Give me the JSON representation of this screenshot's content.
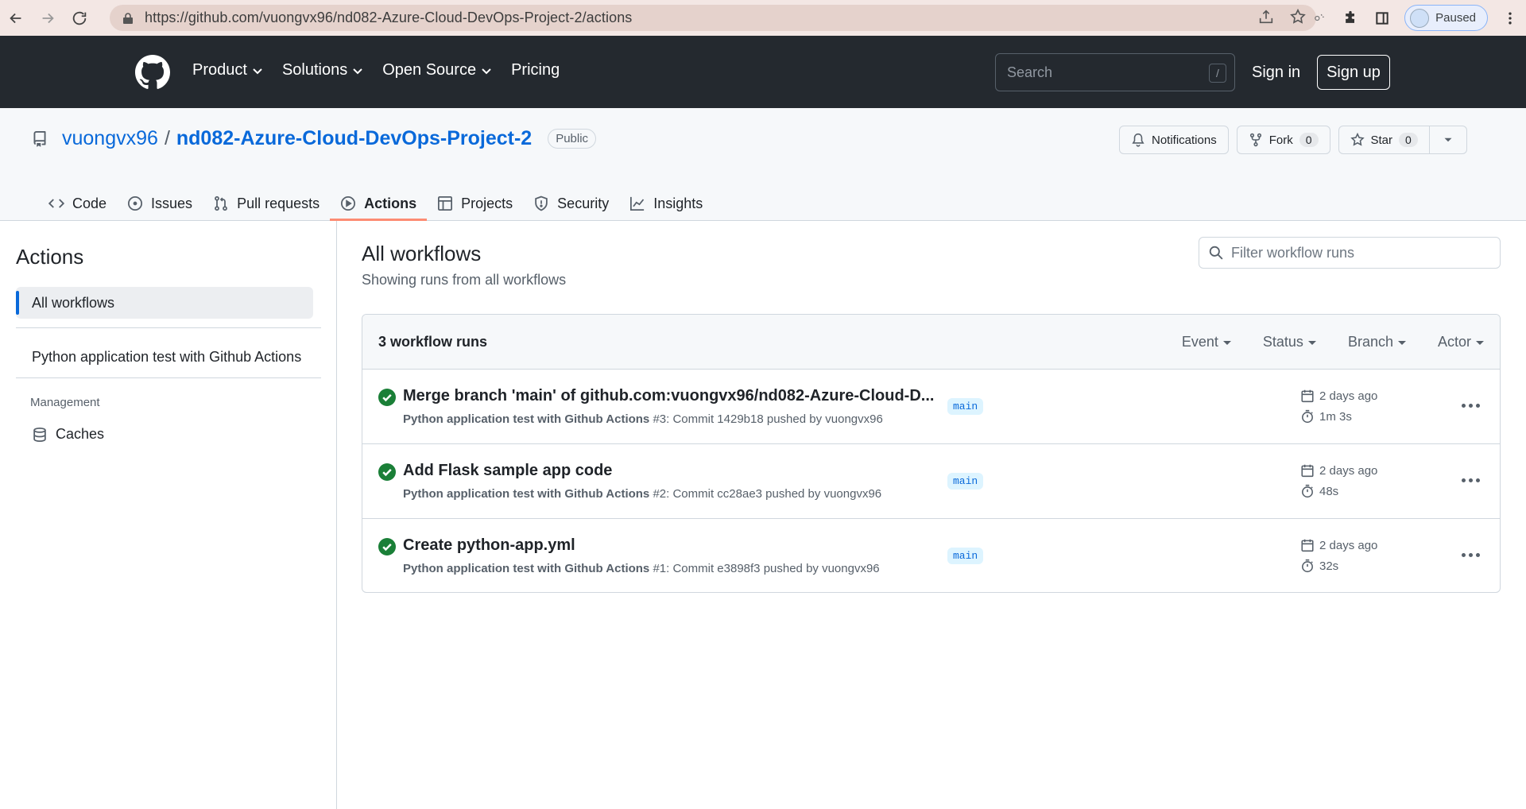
{
  "browser": {
    "url": "https://github.com/vuongvx96/nd082-Azure-Cloud-DevOps-Project-2/actions",
    "profile_label": "Paused"
  },
  "header": {
    "nav": [
      "Product",
      "Solutions",
      "Open Source",
      "Pricing"
    ],
    "search_placeholder": "Search",
    "search_key": "/",
    "sign_in": "Sign in",
    "sign_up": "Sign up"
  },
  "repo": {
    "owner": "vuongvx96",
    "sep": "/",
    "name": "nd082-Azure-Cloud-DevOps-Project-2",
    "visibility": "Public",
    "notifications_label": "Notifications",
    "fork_label": "Fork",
    "fork_count": "0",
    "star_label": "Star",
    "star_count": "0",
    "tabs": [
      {
        "label": "Code",
        "icon": "code-icon"
      },
      {
        "label": "Issues",
        "icon": "issue-icon"
      },
      {
        "label": "Pull requests",
        "icon": "pull-request-icon"
      },
      {
        "label": "Actions",
        "icon": "play-icon"
      },
      {
        "label": "Projects",
        "icon": "table-icon"
      },
      {
        "label": "Security",
        "icon": "shield-icon"
      },
      {
        "label": "Insights",
        "icon": "graph-icon"
      }
    ]
  },
  "sidebar": {
    "title": "Actions",
    "all_workflows": "All workflows",
    "workflows": [
      "Python application test with Github Actions"
    ],
    "management_label": "Management",
    "caches": "Caches"
  },
  "main": {
    "title": "All workflows",
    "subtitle": "Showing runs from all workflows",
    "filter_placeholder": "Filter workflow runs",
    "runs_count": "3 workflow runs",
    "filters": [
      "Event",
      "Status",
      "Branch",
      "Actor"
    ],
    "runs": [
      {
        "title": "Merge branch 'main' of github.com:vuongvx96/nd082-Azure-Cloud-D...",
        "workflow": "Python application test with Github Actions",
        "detail": " #3: Commit 1429b18 pushed by vuongvx96",
        "branch": "main",
        "when": "2 days ago",
        "duration": "1m 3s"
      },
      {
        "title": "Add Flask sample app code",
        "workflow": "Python application test with Github Actions",
        "detail": " #2: Commit cc28ae3 pushed by vuongvx96",
        "branch": "main",
        "when": "2 days ago",
        "duration": "48s"
      },
      {
        "title": "Create python-app.yml",
        "workflow": "Python application test with Github Actions",
        "detail": " #1: Commit e3898f3 pushed by vuongvx96",
        "branch": "main",
        "when": "2 days ago",
        "duration": "32s"
      }
    ]
  },
  "colors": {
    "header_bg": "#24292f",
    "link": "#0969da",
    "success": "#1a7f37",
    "tab_underline": "#fd8c73"
  }
}
